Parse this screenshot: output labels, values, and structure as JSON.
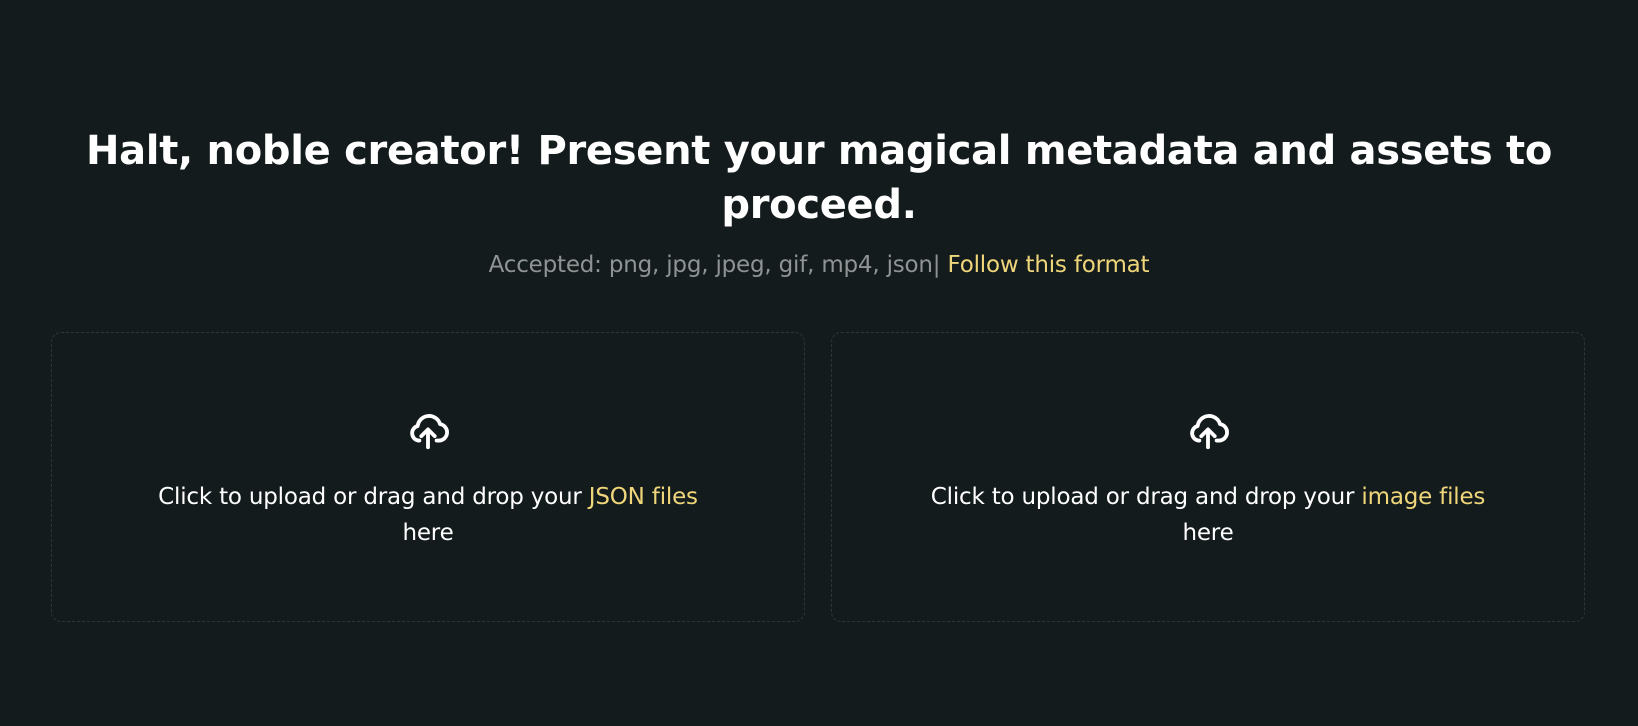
{
  "header": {
    "title": "Halt, noble creator! Present your magical metadata and assets to proceed.",
    "accepted_text": "Accepted: png, jpg, jpeg, gif, mp4, json|",
    "format_link": "Follow this format"
  },
  "dropzones": [
    {
      "icon": "cloud-upload-icon",
      "prefix": "Click to upload or drag and drop your",
      "highlight": "JSON files",
      "suffix": "here"
    },
    {
      "icon": "cloud-upload-icon",
      "prefix": "Click to upload or drag and drop your",
      "highlight": "image files",
      "suffix": "here"
    }
  ],
  "colors": {
    "background": "#141b1d",
    "accent": "#f0d67a",
    "muted_text": "#8f9394",
    "border": "#2e3638"
  }
}
